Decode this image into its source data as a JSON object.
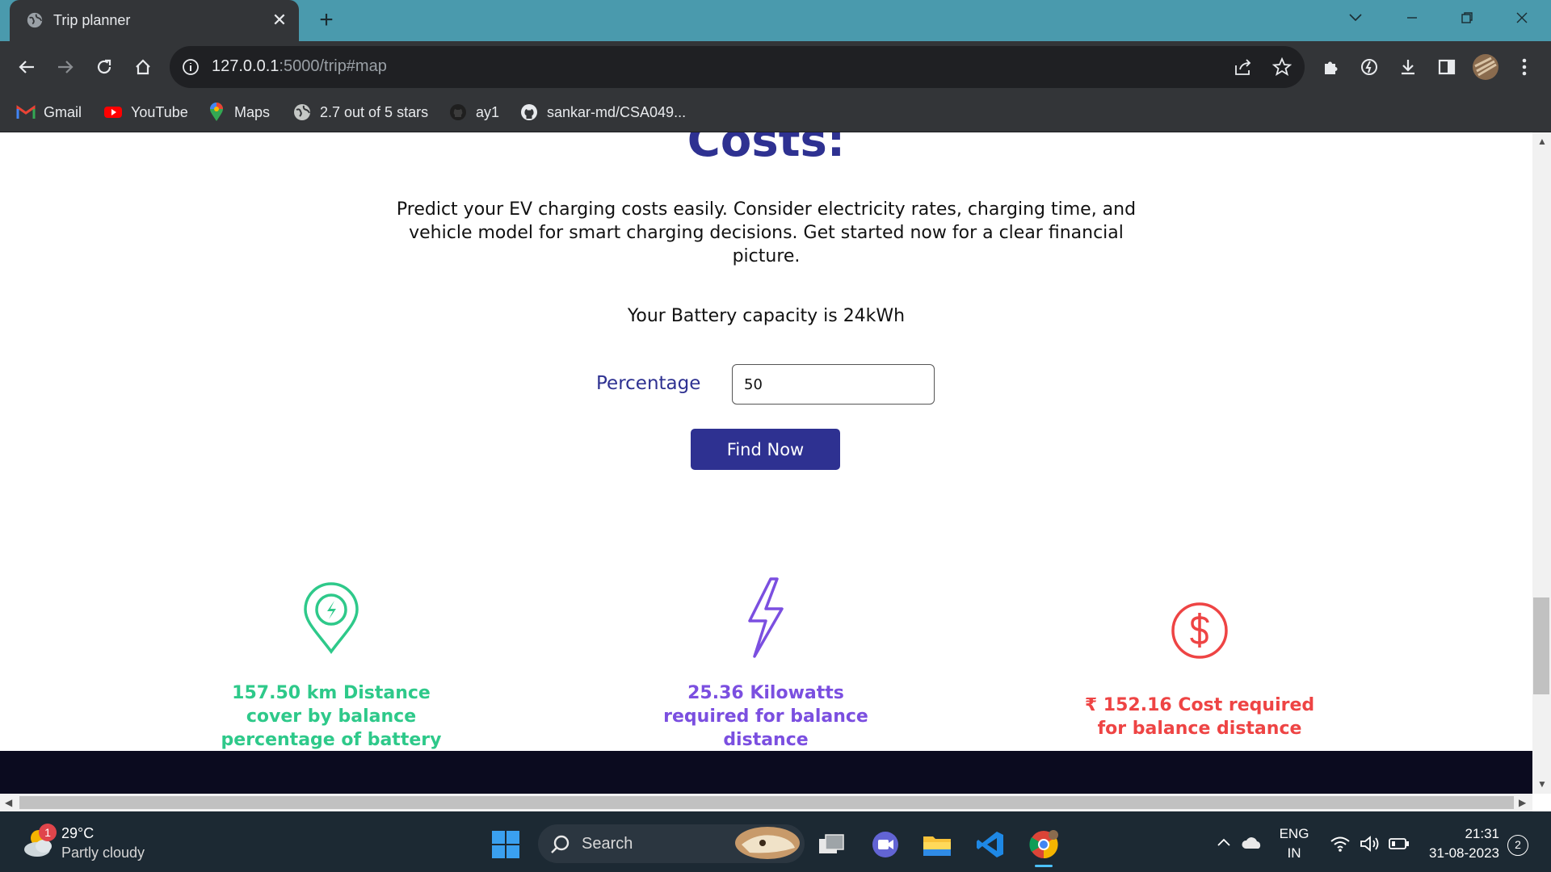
{
  "browser": {
    "tab_title": "Trip planner",
    "url_host": "127.0.0.1",
    "url_rest": ":5000/trip#map",
    "bookmarks": [
      {
        "label": "Gmail",
        "icon": "gmail-icon"
      },
      {
        "label": "YouTube",
        "icon": "youtube-icon"
      },
      {
        "label": "Maps",
        "icon": "maps-icon"
      },
      {
        "label": "2.7 out of 5 stars",
        "icon": "globe-icon"
      },
      {
        "label": "ay1",
        "icon": "github-icon"
      },
      {
        "label": "sankar-md/CSA049...",
        "icon": "github-icon"
      }
    ]
  },
  "page": {
    "heading": "Costs:",
    "description": "Predict your EV charging costs easily. Consider electricity rates, charging time, and vehicle model for smart charging decisions. Get started now for a clear financial picture.",
    "battery_text": "Your Battery capacity is 24kWh",
    "percentage_label": "Percentage",
    "percentage_value": "50",
    "find_button": "Find Now",
    "stats": [
      {
        "text": "157.50 km Distance cover by balance percentage of battery",
        "icon": "charging-pin-icon",
        "color": "#2ec98a"
      },
      {
        "text": "25.36 Kilowatts required for balance distance",
        "icon": "lightning-icon",
        "color": "#7b4fe0"
      },
      {
        "text": "₹ 152.16 Cost required for balance distance",
        "icon": "dollar-circle-icon",
        "color": "#ee4444"
      }
    ]
  },
  "taskbar": {
    "temperature": "29°C",
    "weather": "Partly cloudy",
    "weather_badge": "1",
    "search_placeholder": "Search",
    "language_top": "ENG",
    "language_bottom": "IN",
    "time": "21:31",
    "date": "31-08-2023",
    "notifications": "2"
  }
}
